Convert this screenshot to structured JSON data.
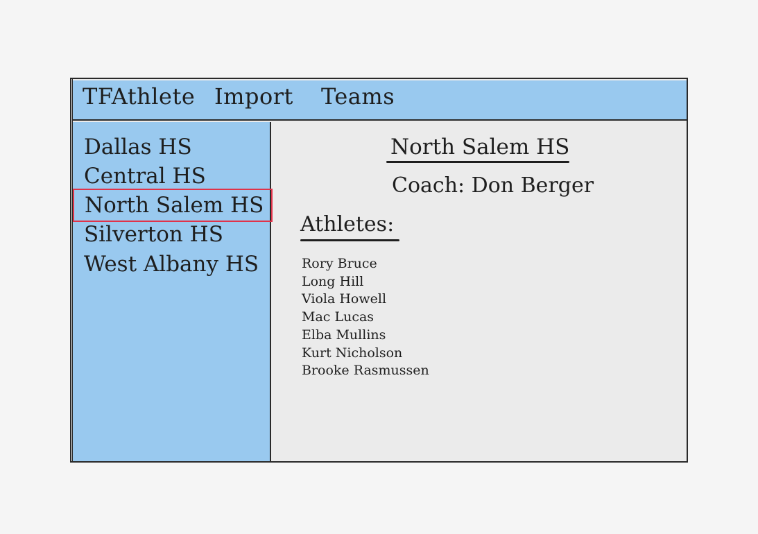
{
  "menubar": {
    "items": [
      {
        "label": "TFAthlete"
      },
      {
        "label": "Import"
      },
      {
        "label": "Teams"
      }
    ]
  },
  "sidebar": {
    "teams": [
      {
        "label": "Dallas HS"
      },
      {
        "label": "Central HS"
      },
      {
        "label": "North Salem HS",
        "selected": true
      },
      {
        "label": "Silverton HS"
      },
      {
        "label": "West Albany HS"
      }
    ]
  },
  "main": {
    "team_name": "North Salem HS",
    "coach": "Coach: Don Berger",
    "athletes_heading": "Athletes:",
    "athletes": [
      "Rory Bruce",
      "Long Hill",
      "Viola Howell",
      "Mac Lucas",
      "Elba Mullins",
      "Kurt Nicholson",
      "Brooke Rasmussen"
    ]
  },
  "colors": {
    "panel_blue": "#99c9ef",
    "content_gray": "#ebebeb",
    "selection_red": "#e0334a",
    "page_background": "#f5f5f5"
  }
}
